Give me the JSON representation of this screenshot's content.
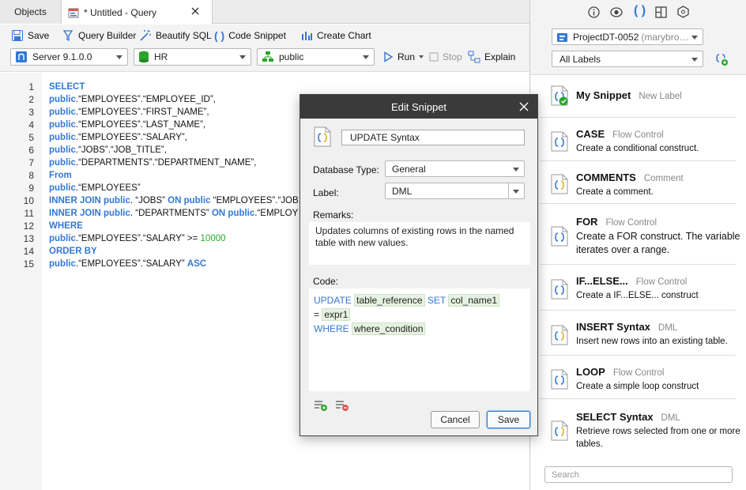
{
  "tabs": {
    "objects": "Objects",
    "query": "* Untitled - Query"
  },
  "toolbar": {
    "save": "Save",
    "query_builder": "Query Builder",
    "beautify": "Beautify SQL",
    "code_snippet": "Code Snippet",
    "create_chart": "Create Chart",
    "server": "Server 9.1.0.0",
    "database": "HR",
    "schema": "public",
    "run": "Run",
    "stop": "Stop",
    "explain": "Explain"
  },
  "editor": {
    "line_numbers": [
      "1",
      "2",
      "3",
      "4",
      "5",
      "6",
      "7",
      "8",
      "9",
      "10",
      "11",
      "12",
      "13",
      "14",
      "15"
    ],
    "lines": [
      [
        {
          "t": "SELECT",
          "c": "kw"
        }
      ],
      [
        {
          "t": "public",
          "c": "kw"
        },
        {
          "t": ".“EMPLOYEES”.“EMPLOYEE_ID”,",
          "c": ""
        }
      ],
      [
        {
          "t": "public",
          "c": "kw"
        },
        {
          "t": ".“EMPLOYEES”.“FIRST_NAME”,",
          "c": ""
        }
      ],
      [
        {
          "t": "public",
          "c": "kw"
        },
        {
          "t": ".“EMPLOYEES”.“LAST_NAME”,",
          "c": ""
        }
      ],
      [
        {
          "t": "public",
          "c": "kw"
        },
        {
          "t": ".“EMPLOYEES”.“SALARY”,",
          "c": ""
        }
      ],
      [
        {
          "t": "public",
          "c": "kw"
        },
        {
          "t": ".“JOBS”.“JOB_TITLE”,",
          "c": ""
        }
      ],
      [
        {
          "t": "public",
          "c": "kw"
        },
        {
          "t": ".“DEPARTMENTS”.“DEPARTMENT_NAME”,",
          "c": ""
        }
      ],
      [
        {
          "t": "From",
          "c": "kw"
        }
      ],
      [
        {
          "t": "public",
          "c": "kw"
        },
        {
          "t": ".“EMPLOYEES”",
          "c": ""
        }
      ],
      [
        {
          "t": "INNER JOIN public",
          "c": "kw"
        },
        {
          "t": ". “JOBS” ",
          "c": ""
        },
        {
          "t": "ON public",
          "c": "kw"
        },
        {
          "t": " “EMPLOYEES”.“JOB",
          "c": ""
        }
      ],
      [
        {
          "t": "INNER JOIN public",
          "c": "kw"
        },
        {
          "t": ". “DEPARTMENTS” ",
          "c": ""
        },
        {
          "t": "ON public",
          "c": "kw"
        },
        {
          "t": ".“EMPLOY",
          "c": ""
        }
      ],
      [
        {
          "t": "WHERE",
          "c": "kw"
        }
      ],
      [
        {
          "t": "public",
          "c": "kw"
        },
        {
          "t": ".“EMPLOYEES”.“SALARY” >= ",
          "c": ""
        },
        {
          "t": "10000",
          "c": "num"
        }
      ],
      [
        {
          "t": "ORDER BY",
          "c": "kw"
        }
      ],
      [
        {
          "t": "public",
          "c": "kw"
        },
        {
          "t": ".“EMPLOYEES”.“SALARY” ",
          "c": ""
        },
        {
          "t": "ASC",
          "c": "kw"
        }
      ]
    ]
  },
  "right": {
    "project": "ProjectDT-0052",
    "project_user": "(marybro…",
    "labels_filter": "All Labels",
    "search_placeholder": "Search",
    "snippets": [
      {
        "name": "My Snippet",
        "label": "New Label",
        "desc": ""
      },
      {
        "name": "CASE",
        "label": "Flow Control",
        "desc": "Create a conditional construct."
      },
      {
        "name": "COMMENTS",
        "label": "Comment",
        "desc": "Create a comment."
      },
      {
        "name": "FOR",
        "label": "Flow Control",
        "desc": "Create a FOR construct. The variable iterates over a range."
      },
      {
        "name": "IF...ELSE...",
        "label": "Flow Control",
        "desc": "Create a IF...ELSE... construct"
      },
      {
        "name": "INSERT Syntax",
        "label": "DML",
        "desc": "Insert new rows into an existing table."
      },
      {
        "name": "LOOP",
        "label": "Flow Control",
        "desc": "Create a simple loop construct"
      },
      {
        "name": "SELECT Syntax",
        "label": "DML",
        "desc": "Retrieve rows selected from one or more tables."
      }
    ]
  },
  "dialog": {
    "title": "Edit Snippet",
    "name": "UPDATE Syntax",
    "db_type_label": "Database Type:",
    "db_type": "General",
    "label_label": "Label:",
    "label": "DML",
    "remarks_label": "Remarks:",
    "remarks": "Updates columns of existing rows in the named table with new values.",
    "code_label": "Code:",
    "code": {
      "kw1": "UPDATE",
      "t1": "table_reference",
      "kw2": "SET",
      "t2": "col_name1",
      "eq": "=",
      "t3": "expr1",
      "kw3": "WHERE",
      "t4": "where_condition"
    },
    "cancel": "Cancel",
    "save": "Save"
  },
  "colors": {
    "accent": "#3478d4",
    "number": "#2aa52a",
    "token_bg": "#e6f2e1"
  }
}
